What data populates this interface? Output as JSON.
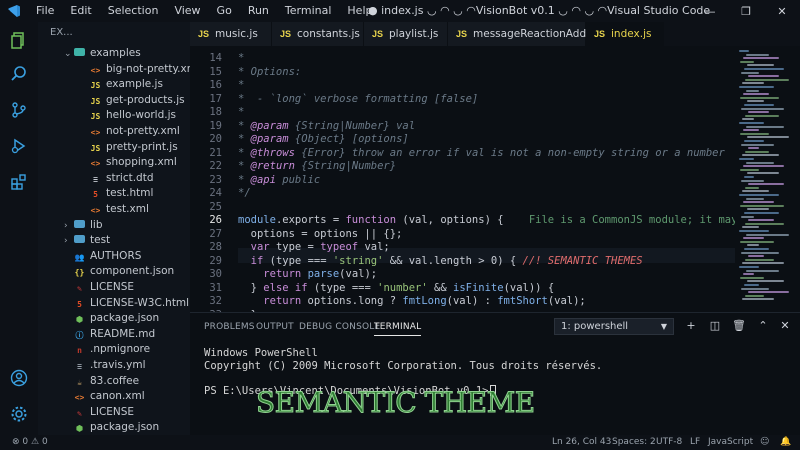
{
  "window": {
    "title": "● index.js ◡ ◠ ◡ ◠VisionBot v0.1 ◡ ◠ ◡ ◠Visual Studio Code",
    "menus": [
      "File",
      "Edit",
      "Selection",
      "View",
      "Go",
      "Run",
      "Terminal",
      "Help"
    ]
  },
  "sidebar": {
    "header": "EX...",
    "items": [
      {
        "label": "examples",
        "kind": "folder-open",
        "depth": 1
      },
      {
        "label": "big-not-pretty.xml",
        "kind": "xml",
        "depth": 2
      },
      {
        "label": "example.js",
        "kind": "js",
        "depth": 2
      },
      {
        "label": "get-products.js",
        "kind": "js",
        "depth": 2
      },
      {
        "label": "hello-world.js",
        "kind": "js",
        "depth": 2
      },
      {
        "label": "not-pretty.xml",
        "kind": "xml",
        "depth": 2
      },
      {
        "label": "pretty-print.js",
        "kind": "js",
        "depth": 2
      },
      {
        "label": "shopping.xml",
        "kind": "xml",
        "depth": 2
      },
      {
        "label": "strict.dtd",
        "kind": "dtd",
        "depth": 2
      },
      {
        "label": "test.html",
        "kind": "html",
        "depth": 2
      },
      {
        "label": "test.xml",
        "kind": "xml",
        "depth": 2
      },
      {
        "label": "lib",
        "kind": "folder",
        "depth": 1
      },
      {
        "label": "test",
        "kind": "folder",
        "depth": 1
      },
      {
        "label": "AUTHORS",
        "kind": "authors",
        "depth": 1
      },
      {
        "label": "component.json",
        "kind": "json",
        "depth": 1
      },
      {
        "label": "LICENSE",
        "kind": "license",
        "depth": 1
      },
      {
        "label": "LICENSE-W3C.html",
        "kind": "html",
        "depth": 1
      },
      {
        "label": "package.json",
        "kind": "node",
        "depth": 1
      },
      {
        "label": "README.md",
        "kind": "md",
        "depth": 1
      },
      {
        "label": ".npmignore",
        "kind": "npm",
        "depth": 0
      },
      {
        "label": ".travis.yml",
        "kind": "yml",
        "depth": 0
      },
      {
        "label": "83.coffee",
        "kind": "coffee",
        "depth": 0
      },
      {
        "label": "canon.xml",
        "kind": "xml",
        "depth": 0
      },
      {
        "label": "LICENSE",
        "kind": "license",
        "depth": 0
      },
      {
        "label": "package.json",
        "kind": "node",
        "depth": 0
      }
    ]
  },
  "tabs": [
    {
      "prefix": "JS",
      "label": "music.js"
    },
    {
      "prefix": "JS",
      "label": "constants.js"
    },
    {
      "prefix": "JS",
      "label": "playlist.js"
    },
    {
      "prefix": "JS",
      "label": "messageReactionAdd.js"
    },
    {
      "prefix": "JS",
      "label": "index.js"
    }
  ],
  "editor": {
    "line_numbers": [
      "14",
      "15",
      "16",
      "17",
      "18",
      "19",
      "20",
      "21",
      "22",
      "23",
      "24",
      "25",
      "26",
      "27",
      "28",
      "29",
      "30",
      "31",
      "32",
      "33"
    ],
    "lines": [
      "*",
      "* Options:",
      "*",
      "*  - `long` verbose formatting [false]",
      "*",
      "* @param {String|Number} val",
      "* @param {Object} [options]",
      "* @throws {Error} throw an error if val is not a non-empty string or a number",
      "* @return {String|Number}",
      "* @api public",
      "*/",
      "",
      "module.exports = function (val, options) {",
      "  options = options || {};",
      "  var type = typeof val;",
      "  if (type === 'string' && val.length > 0) {",
      "    return parse(val);",
      "  } else if (type === 'number' && isFinite(val)) {",
      "    return options.long ? fmtLong(val) : fmtShort(val);",
      "  }"
    ],
    "inline_hint": "File is a CommonJS module; it may be c",
    "error_comment": "//! SEMANTIC THEMES"
  },
  "panel": {
    "tabs": [
      "PROBLEMS",
      "OUTPUT",
      "DEBUG CONSOLE",
      "TERMINAL"
    ],
    "active_tab": "TERMINAL",
    "terminal_select": "1: powershell",
    "terminal_lines": [
      "Windows PowerShell",
      "Copyright (C) 2009 Microsoft Corporation. Tous droits réservés.",
      "",
      "PS E:\\Users\\Vincent\\Documents\\VisionBot v0.1>"
    ],
    "overlay_text": "SEMANTIC THEME"
  },
  "statusbar": {
    "errors": "0",
    "warnings": "0",
    "position": "Ln 26, Col 43",
    "spaces": "Spaces: 2",
    "encoding": "UTF-8",
    "eol": "LF",
    "language": "JavaScript"
  },
  "colors": {
    "background": "#0b0f14",
    "accent_js": "#e8d44d",
    "keyword": "#c88dd8",
    "function": "#7fb0e8",
    "string": "#98c379",
    "error": "#e06c6c",
    "overlay": "#2e7d32"
  }
}
